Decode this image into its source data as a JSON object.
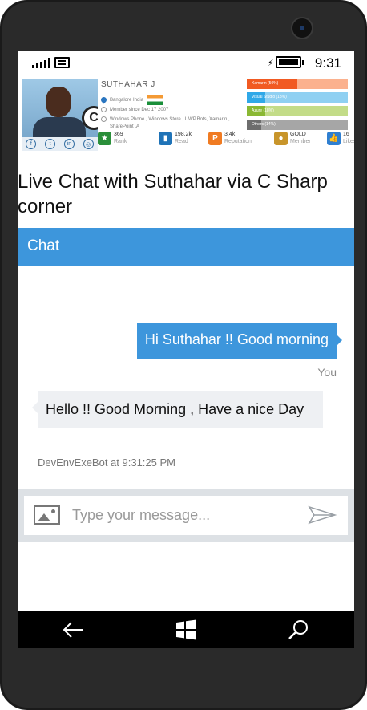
{
  "status": {
    "time": "9:31"
  },
  "profile": {
    "name": "SUTHAHAR J",
    "location": "Bangalore India",
    "member_since": "Member since Dec 17 2007",
    "technologies": "Windows Phone , Windows Store , UWP,Bots, Xamarin , SharePoint ,A",
    "skills": [
      {
        "label": "Xamarin (50%)",
        "value": 50,
        "color": "#f15a22",
        "track": "#fbb18e"
      },
      {
        "label": "Visual Studio (18%)",
        "value": 18,
        "color": "#2fa8e8",
        "track": "#8fd0f2"
      },
      {
        "label": "Azure (18%)",
        "value": 18,
        "color": "#8ab833",
        "track": "#c3dc88"
      },
      {
        "label": "Others (14%)",
        "value": 14,
        "color": "#6d6d6d",
        "track": "#a6a6a6"
      }
    ],
    "stats": [
      {
        "value": "369",
        "label": "Rank",
        "icon": "star-badge-icon",
        "color": "#2a8f3a"
      },
      {
        "value": "198.2k",
        "label": "Read",
        "icon": "book-icon",
        "color": "#1f73b7"
      },
      {
        "value": "3.4k",
        "label": "Reputation",
        "icon": "points-icon",
        "color": "#f07b22"
      },
      {
        "value": "GOLD",
        "label": "Member",
        "icon": "medal-icon",
        "color": "#c8952b"
      },
      {
        "value": "16",
        "label": "Likes",
        "icon": "thumbs-up-icon",
        "color": "#2f7fd1"
      }
    ]
  },
  "page": {
    "title": "Live Chat with Suthahar via C Sharp corner"
  },
  "chat": {
    "header": "Chat",
    "outgoing": {
      "text": "Hi Suthahar !! Good morning",
      "sender": "You"
    },
    "incoming": {
      "text": "Hello !! Good Morning , Have a nice Day",
      "sender": "DevEnvExeBot at 9:31:25 PM"
    }
  },
  "composer": {
    "placeholder": "Type your message..."
  },
  "colors": {
    "accent": "#3d96dc",
    "bubble_in": "#eef0f3"
  }
}
